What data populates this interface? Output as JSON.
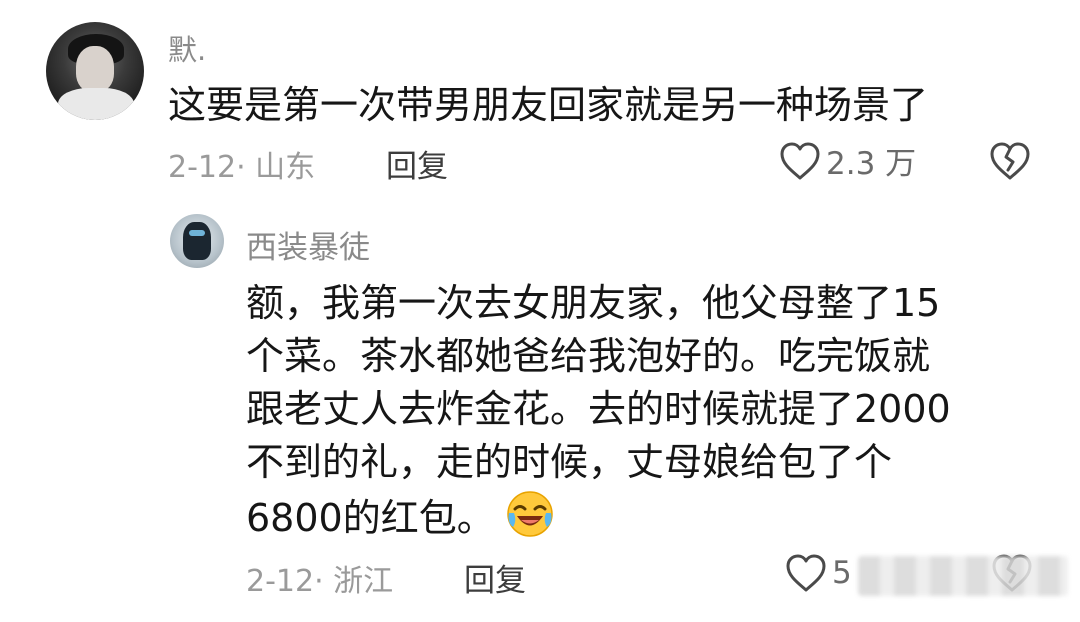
{
  "comments": [
    {
      "username": "默.",
      "text": "这要是第一次带男朋友回家就是另一种场景了",
      "meta": "2-12· 山东",
      "reply_label": "回复",
      "like_count": "2.3 万",
      "icons": {
        "like": "heart-outline-icon",
        "dislike": "broken-heart-icon"
      }
    },
    {
      "username": "西装暴徒",
      "text_lines": [
        "额，我第一次去女朋友家，他父母整了15",
        "个菜。茶水都她爸给我泡好的。吃完饭就",
        "跟老丈人去炸金花。去的时候就提了2000",
        "不到的礼，走的时候，丈母娘给包了个",
        "6800的红包。"
      ],
      "emoji": "laugh-cry-emoji",
      "meta": "2-12· 浙江",
      "reply_label": "回复",
      "like_count": "5",
      "icons": {
        "like": "heart-outline-icon",
        "dislike": "broken-heart-icon"
      }
    }
  ]
}
